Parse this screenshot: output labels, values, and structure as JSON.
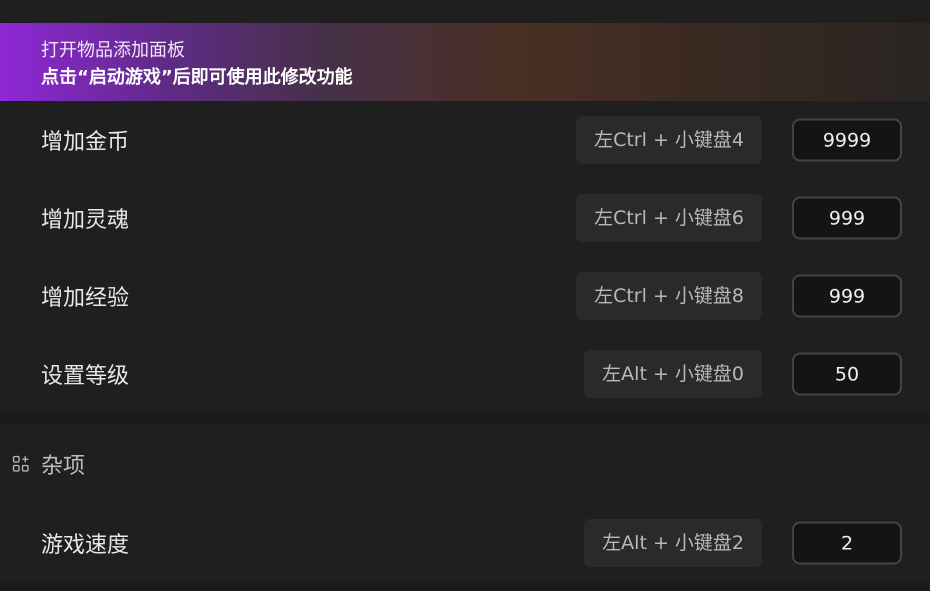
{
  "banner": {
    "line1": "打开物品添加面板",
    "line2": "点击“启动游戏”后即可使用此修改功能"
  },
  "cheats": [
    {
      "label": "增加金币",
      "hotkey": "左Ctrl + 小键盘4",
      "value": "9999"
    },
    {
      "label": "增加灵魂",
      "hotkey": "左Ctrl + 小键盘6",
      "value": "999"
    },
    {
      "label": "增加经验",
      "hotkey": "左Ctrl + 小键盘8",
      "value": "999"
    },
    {
      "label": "设置等级",
      "hotkey": "左Alt + 小键盘0",
      "value": "50"
    }
  ],
  "misc_section": {
    "title": "杂项",
    "icon": "apps-add-icon",
    "rows": [
      {
        "label": "游戏速度",
        "hotkey": "左Alt + 小键盘2",
        "value": "2"
      }
    ]
  }
}
